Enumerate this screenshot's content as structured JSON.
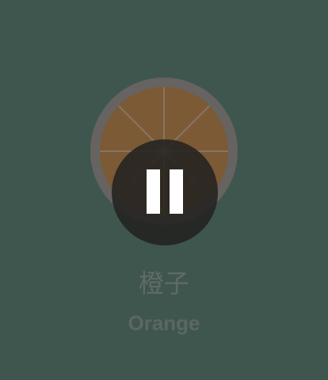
{
  "item": {
    "name_cn": "橙子",
    "name_en": "Orange",
    "icon": "orange-slice-icon"
  },
  "player": {
    "state": "paused",
    "control_icon": "pause-icon"
  },
  "colors": {
    "background": "#3f564f",
    "orange_flesh": "#7b5a35",
    "orange_rind": "#666360",
    "button_fill": "#22211f",
    "text": "#5f6b66"
  }
}
